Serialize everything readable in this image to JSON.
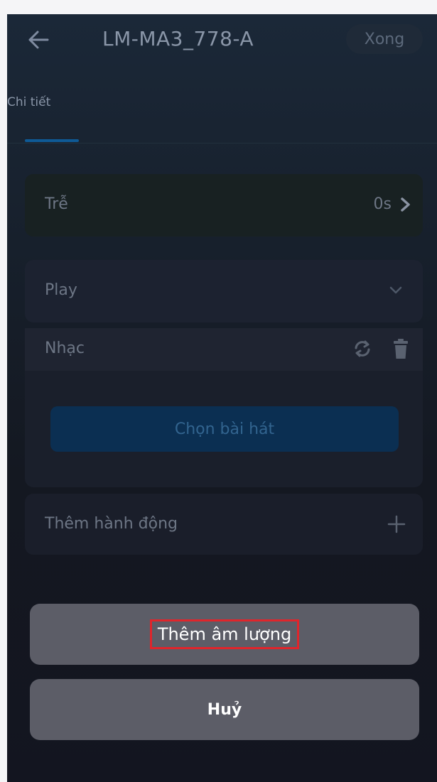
{
  "header": {
    "title": "LM-MA3_778-A",
    "done_label": "Xong",
    "back_icon": "arrow-left-icon"
  },
  "tabs": [
    {
      "label": "Chi tiết",
      "active": true
    }
  ],
  "delay": {
    "label": "Trễ",
    "value": "0s"
  },
  "play": {
    "label": "Play"
  },
  "music": {
    "label": "Nhạc",
    "choose_song_label": "Chọn bài hát"
  },
  "add_action": {
    "label": "Thêm hành động"
  },
  "action_sheet": {
    "add_volume_label": "Thêm âm lượng",
    "cancel_label": "Huỷ"
  },
  "colors": {
    "accent": "#0e5a96",
    "highlight_box": "#e0252b",
    "sheet_button": "#5c5d67"
  }
}
